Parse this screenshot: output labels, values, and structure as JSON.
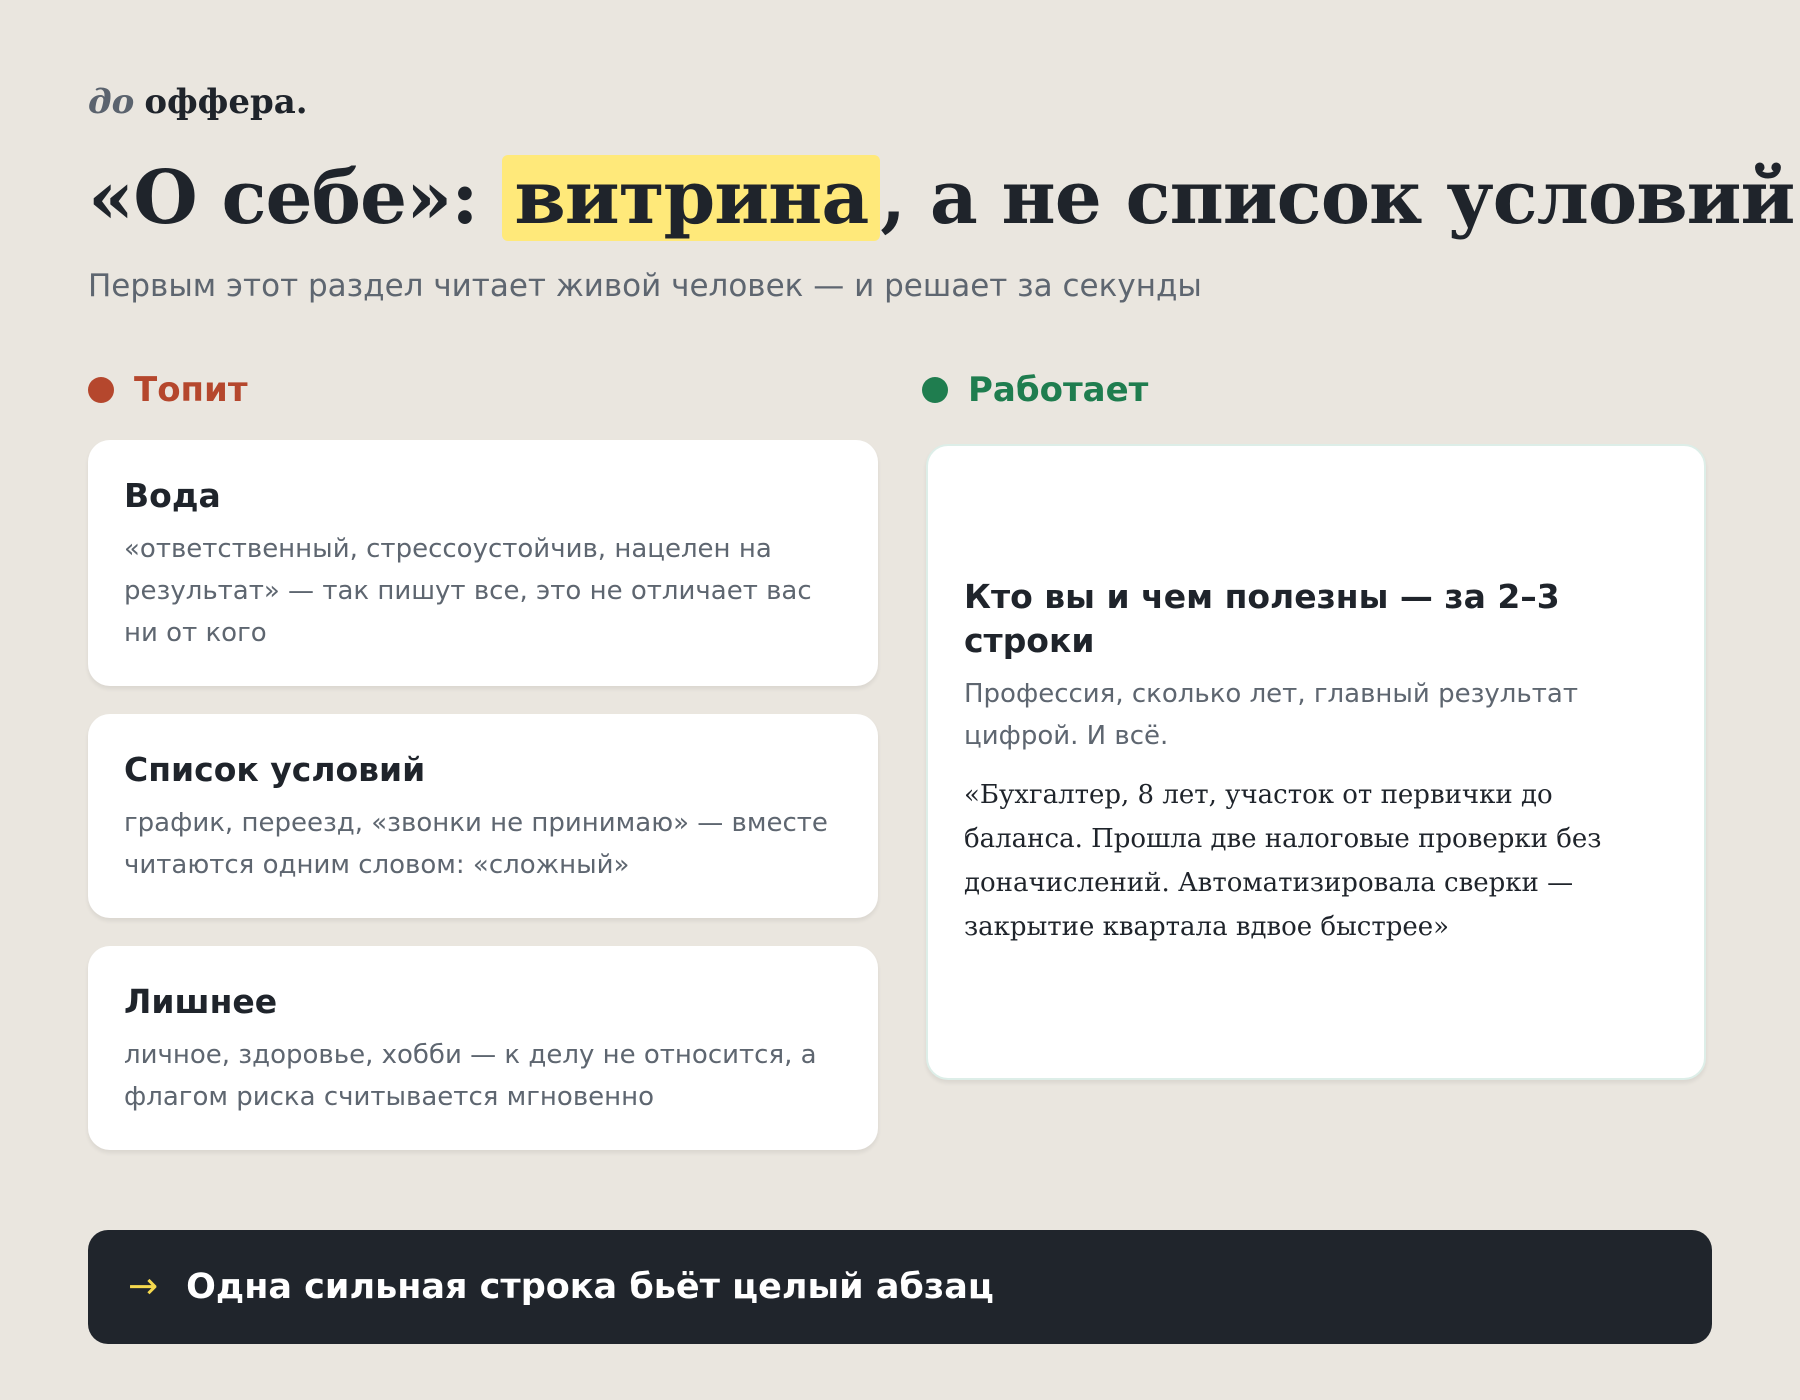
{
  "brand": {
    "prefix": "до",
    "name": "оффера."
  },
  "header": {
    "title_before": "«О себе»:",
    "title_highlight": "витрина",
    "title_after": ", а не список условий",
    "highlight_color": "#FFE97A",
    "subtitle": "Первым этот раздел читает живой человек — и решает за секунды"
  },
  "bad_column": {
    "label": "Топит",
    "color": "#B5472D",
    "items": [
      {
        "title": "Вода",
        "text": "«ответственный, стрессоустойчив, нацелен на результат» — так пишут все, это не отличает вас ни от кого"
      },
      {
        "title": "Список условий",
        "text": "график, переезд, «звонки не принимаю» — вместе читаются одним словом: «сложный»"
      },
      {
        "title": "Лишнее",
        "text": "личное, здоровье, хобби — к делу не относится, а флагом риска считывается мгновенно"
      }
    ]
  },
  "good_column": {
    "label": "Работает",
    "color": "#1F7D4F",
    "card": {
      "title": "Кто вы и чем полезны — за 2–3 строки",
      "text": "Профессия, сколько лет, главный результат цифрой. И всё.",
      "quote": "«Бухгалтер, 8 лет, участок от первички до баланса. Прошла две налоговые проверки без доначислений. Автоматизировала сверки — закрытие квартала вдвое быстрее»"
    }
  },
  "footer": {
    "arrow_icon": "→",
    "text": "Одна сильная строка бьёт целый абзац",
    "accent_color": "#F5D94E"
  }
}
